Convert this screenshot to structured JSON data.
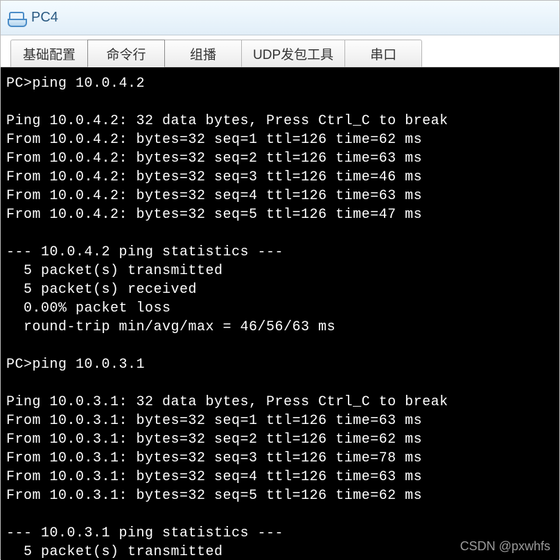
{
  "window": {
    "title": "PC4"
  },
  "tabs": {
    "basic": {
      "label": "基础配置"
    },
    "cli": {
      "label": "命令行"
    },
    "mcast": {
      "label": "组播"
    },
    "udp": {
      "label": "UDP发包工具"
    },
    "serial": {
      "label": "串口"
    },
    "active_key": "cli"
  },
  "terminal": {
    "prompt": "PC>",
    "sessions": [
      {
        "cmd": "ping 10.0.4.2",
        "target": "10.0.4.2",
        "header": "Ping 10.0.4.2: 32 data bytes, Press Ctrl_C to break",
        "replies": [
          "From 10.0.4.2: bytes=32 seq=1 ttl=126 time=62 ms",
          "From 10.0.4.2: bytes=32 seq=2 ttl=126 time=63 ms",
          "From 10.0.4.2: bytes=32 seq=3 ttl=126 time=46 ms",
          "From 10.0.4.2: bytes=32 seq=4 ttl=126 time=63 ms",
          "From 10.0.4.2: bytes=32 seq=5 ttl=126 time=47 ms"
        ],
        "stats_header": "--- 10.0.4.2 ping statistics ---",
        "stats": [
          "  5 packet(s) transmitted",
          "  5 packet(s) received",
          "  0.00% packet loss",
          "  round-trip min/avg/max = 46/56/63 ms"
        ]
      },
      {
        "cmd": "ping 10.0.3.1",
        "target": "10.0.3.1",
        "header": "Ping 10.0.3.1: 32 data bytes, Press Ctrl_C to break",
        "replies": [
          "From 10.0.3.1: bytes=32 seq=1 ttl=126 time=63 ms",
          "From 10.0.3.1: bytes=32 seq=2 ttl=126 time=62 ms",
          "From 10.0.3.1: bytes=32 seq=3 ttl=126 time=78 ms",
          "From 10.0.3.1: bytes=32 seq=4 ttl=126 time=63 ms",
          "From 10.0.3.1: bytes=32 seq=5 ttl=126 time=62 ms"
        ],
        "stats_header": "--- 10.0.3.1 ping statistics ---",
        "stats": [
          "  5 packet(s) transmitted"
        ]
      }
    ]
  },
  "watermark": "CSDN @pxwhfs"
}
